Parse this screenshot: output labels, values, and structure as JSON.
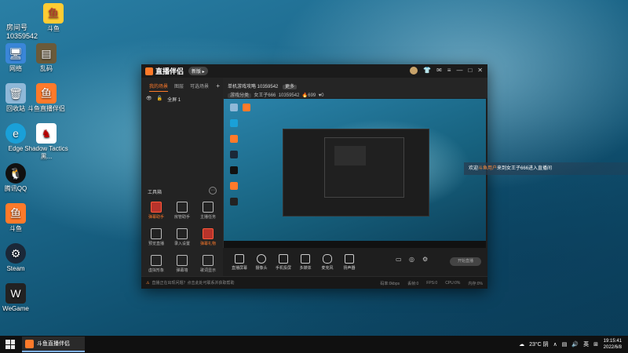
{
  "desktop": {
    "icons": [
      {
        "label": "斗鱼",
        "icon": "douyu-icon"
      },
      {
        "label": "网络",
        "icon": "network-icon"
      },
      {
        "label": "乱码",
        "icon": "folder-icon"
      },
      {
        "label": "回收站",
        "icon": "recycle-bin-icon"
      },
      {
        "label": "斗鱼直播伴侣",
        "icon": "douyu-icon"
      },
      {
        "label": "Edge",
        "icon": "edge-icon"
      },
      {
        "label": "Shadow Tactics 黑...",
        "icon": "game-icon"
      },
      {
        "label": "腾讯QQ",
        "icon": "qq-icon"
      },
      {
        "label": "斗鱼",
        "icon": "douyu-icon"
      },
      {
        "label": "Steam",
        "icon": "steam-icon"
      },
      {
        "label": "WeGame",
        "icon": "wegame-icon"
      }
    ],
    "room_label": "房间号",
    "room_number": "10359542"
  },
  "app": {
    "name": "直播伴侣",
    "badge": "新版 ▸",
    "tabs": [
      "我的场景",
      "图层",
      "可选场景"
    ],
    "scene_item": "全屏 1",
    "room_title": "单机游戏攻略 10359542",
    "room_tag": "更多",
    "category": "游戏分类",
    "streamer": "女王子666",
    "room_id": "10359542",
    "hot": "699",
    "fans": "0",
    "tools_title": "工具箱",
    "tools": [
      "弹幕助手",
      "房管助手",
      "主播任务",
      "预览直播",
      "录入设置",
      "弹幕礼物",
      "虚拟形象",
      "弹幕墙",
      "歌词显示"
    ],
    "bottom_items": [
      "直播屏幕",
      "摄像头",
      "手机投屏",
      "多媒体",
      "麦克风",
      "扬声器"
    ],
    "start_button": "开始直播",
    "status_warning": "直播正在出现问题？点击此处可联系并获取帮助",
    "stats": [
      "码率:0kbps",
      "丢帧:0",
      "FPS:0",
      "CPU:0%",
      "内存:0%"
    ],
    "accent": "#ff7a2a"
  },
  "danmu": {
    "prefix": "欢迎",
    "nickname": "斗鱼用户",
    "suffix": "来到女王子666进入直播间"
  },
  "taskbar": {
    "app_label": "斗鱼直播伴侣",
    "weather": "23°C 阴",
    "ime": "英",
    "time": "19:15:41",
    "date": "2022/6/8"
  }
}
